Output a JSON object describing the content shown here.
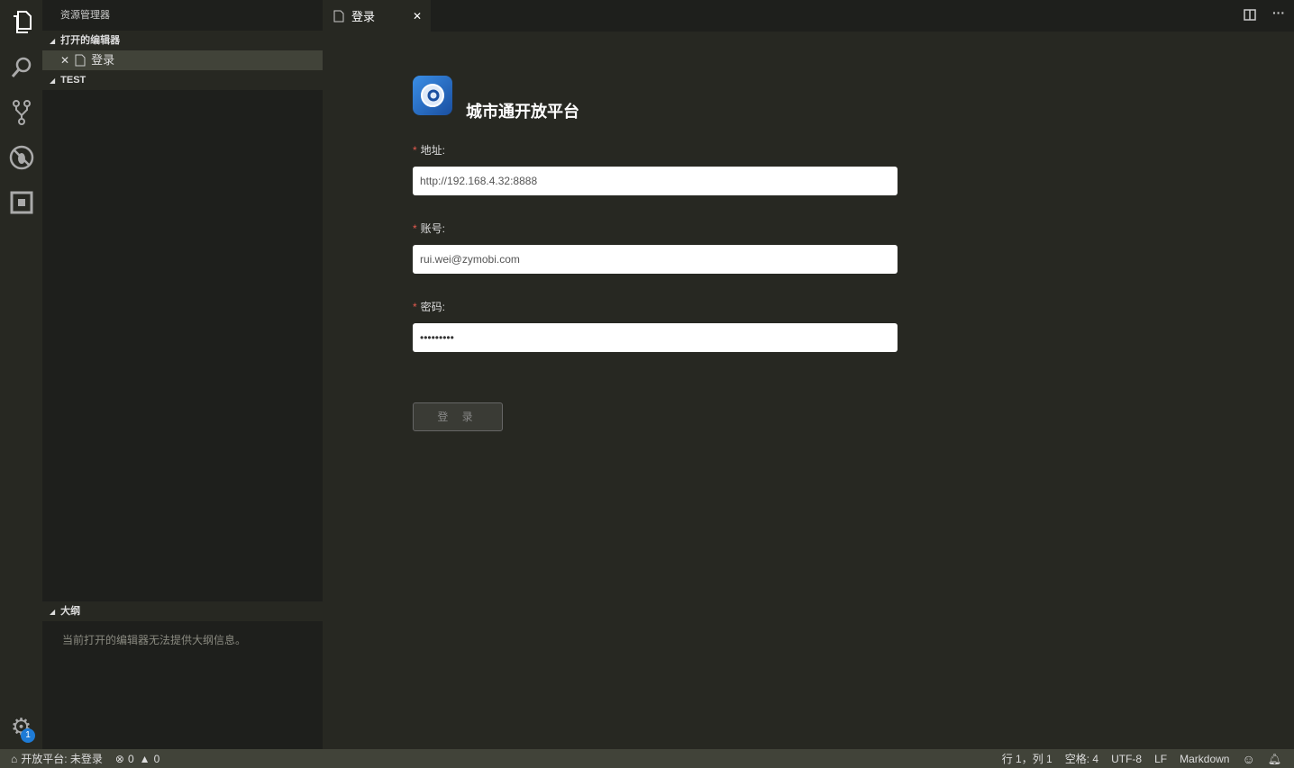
{
  "sidebar": {
    "title": "资源管理器",
    "open_editors": "打开的编辑器",
    "open_file": "登录",
    "folder": "TEST",
    "outline": "大纲",
    "outline_msg": "当前打开的编辑器无法提供大纲信息。"
  },
  "tab": {
    "label": "登录"
  },
  "form": {
    "title": "城市通开放平台",
    "address_label": "地址:",
    "address_value": "http://192.168.4.32:8888",
    "account_label": "账号:",
    "account_value": "rui.wei@zymobi.com",
    "password_label": "密码:",
    "password_value": "•••••••••",
    "login_button": "登 录"
  },
  "activity": {
    "settings_badge": "1"
  },
  "status": {
    "platform": "开放平台: 未登录",
    "errors": "0",
    "warnings": "0",
    "position": "行 1，列 1",
    "spaces": "空格: 4",
    "encoding": "UTF-8",
    "eol": "LF",
    "language": "Markdown"
  }
}
